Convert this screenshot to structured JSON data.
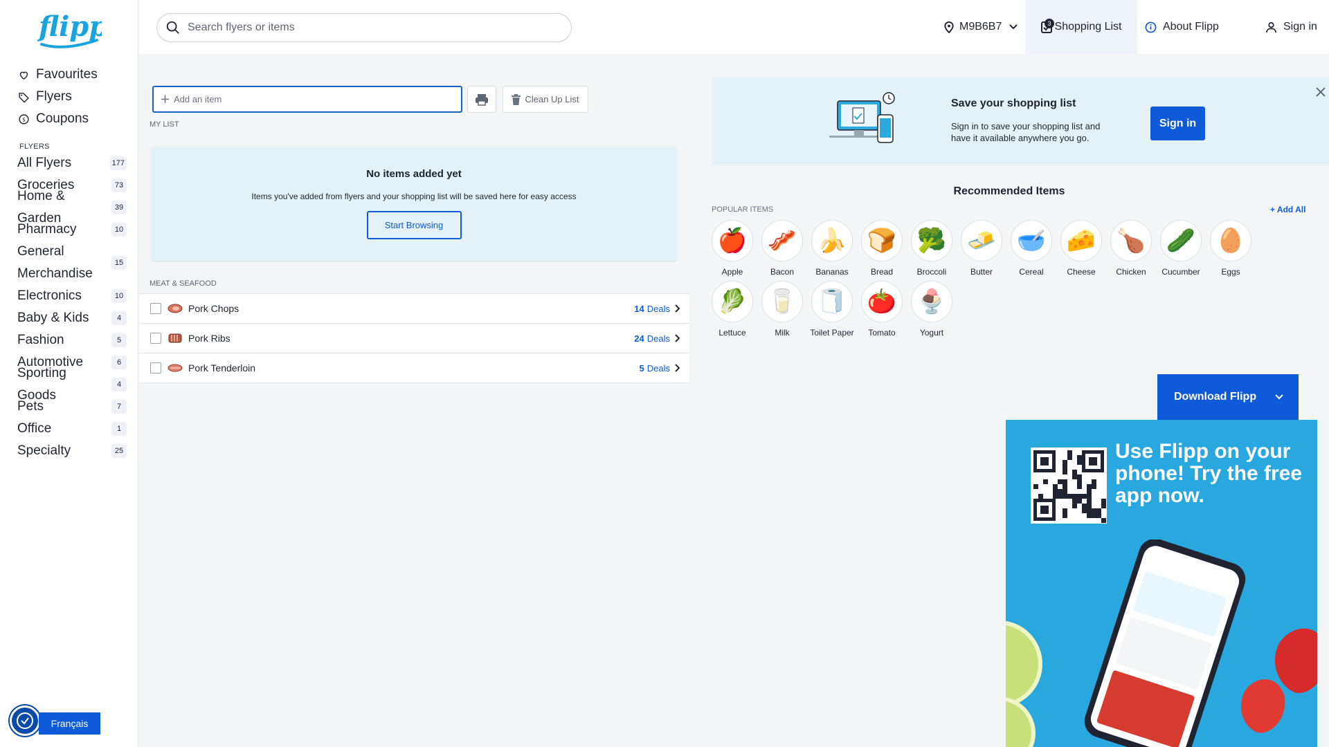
{
  "sidebar": {
    "logo_text": "flipp",
    "top_nav": [
      {
        "label": "Favourites",
        "icon": "heart-icon"
      },
      {
        "label": "Flyers",
        "icon": "tag-icon"
      },
      {
        "label": "Coupons",
        "icon": "coupon-icon"
      }
    ],
    "flyers_heading": "FLYERS",
    "categories": [
      {
        "label": "All Flyers",
        "count": "177"
      },
      {
        "label": "Groceries",
        "count": "73"
      },
      {
        "label": "Home & Garden",
        "count": "39"
      },
      {
        "label": "Pharmacy",
        "count": "10"
      },
      {
        "label": "General Merchandise",
        "count": "15"
      },
      {
        "label": "Electronics",
        "count": "10"
      },
      {
        "label": "Baby & Kids",
        "count": "4"
      },
      {
        "label": "Fashion",
        "count": "5"
      },
      {
        "label": "Automotive",
        "count": "6"
      },
      {
        "label": "Sporting Goods",
        "count": "4"
      },
      {
        "label": "Pets",
        "count": "7"
      },
      {
        "label": "Office",
        "count": "1"
      },
      {
        "label": "Specialty",
        "count": "25"
      }
    ],
    "language_button": "Français"
  },
  "header": {
    "search_placeholder": "Search flyers or items",
    "postal_code": "M9B6B7",
    "shopping_list_label": "Shopping List",
    "shopping_list_badge": "3",
    "about_label": "About Flipp",
    "signin_label": "Sign in"
  },
  "my_list": {
    "add_item_placeholder": "Add an item",
    "cleanup_label": "Clean Up List",
    "section_label": "MY LIST",
    "empty_title": "No items added yet",
    "empty_desc": "Items you've added from flyers and your shopping list will be saved here for easy access",
    "start_browsing": "Start Browsing",
    "category_label": "MEAT & SEAFOOD",
    "items": [
      {
        "name": "Pork Chops",
        "deals_count": "14",
        "deals_word": "Deals"
      },
      {
        "name": "Pork Ribs",
        "deals_count": "24",
        "deals_word": "Deals"
      },
      {
        "name": "Pork Tenderloin",
        "deals_count": "5",
        "deals_word": "Deals"
      }
    ]
  },
  "save_banner": {
    "title": "Save your shopping list",
    "description": "Sign in to save your shopping list and have it available anywhere you go.",
    "signin": "Sign in"
  },
  "recommended": {
    "title": "Recommended Items",
    "popular_label": "POPULAR ITEMS",
    "add_all": "+ Add All",
    "items": [
      {
        "label": "Apple",
        "icon": "apple-icon",
        "glyph": "🍎"
      },
      {
        "label": "Bacon",
        "icon": "bacon-icon",
        "glyph": "🥓"
      },
      {
        "label": "Bananas",
        "icon": "banana-icon",
        "glyph": "🍌"
      },
      {
        "label": "Bread",
        "icon": "bread-icon",
        "glyph": "🍞"
      },
      {
        "label": "Broccoli",
        "icon": "broccoli-icon",
        "glyph": "🥦"
      },
      {
        "label": "Butter",
        "icon": "butter-icon",
        "glyph": "🧈"
      },
      {
        "label": "Cereal",
        "icon": "cereal-icon",
        "glyph": "🥣"
      },
      {
        "label": "Cheese",
        "icon": "cheese-icon",
        "glyph": "🧀"
      },
      {
        "label": "Chicken",
        "icon": "chicken-icon",
        "glyph": "🍗"
      },
      {
        "label": "Cucumber",
        "icon": "cucumber-icon",
        "glyph": "🥒"
      },
      {
        "label": "Eggs",
        "icon": "eggs-icon",
        "glyph": "🥚"
      },
      {
        "label": "Lettuce",
        "icon": "lettuce-icon",
        "glyph": "🥬"
      },
      {
        "label": "Milk",
        "icon": "milk-icon",
        "glyph": "🥛"
      },
      {
        "label": "Toilet Paper",
        "icon": "toilet-paper-icon",
        "glyph": "🧻"
      },
      {
        "label": "Tomato",
        "icon": "tomato-icon",
        "glyph": "🍅"
      },
      {
        "label": "Yogurt",
        "icon": "yogurt-icon",
        "glyph": "🍨"
      }
    ]
  },
  "download": {
    "label": "Download Flipp",
    "promo_text": "Use Flipp on your phone! Try the free app now."
  },
  "colors": {
    "accent": "#0f5ad9",
    "banner_bg": "#e4f1f7",
    "promo_bg": "#29a8e0"
  }
}
